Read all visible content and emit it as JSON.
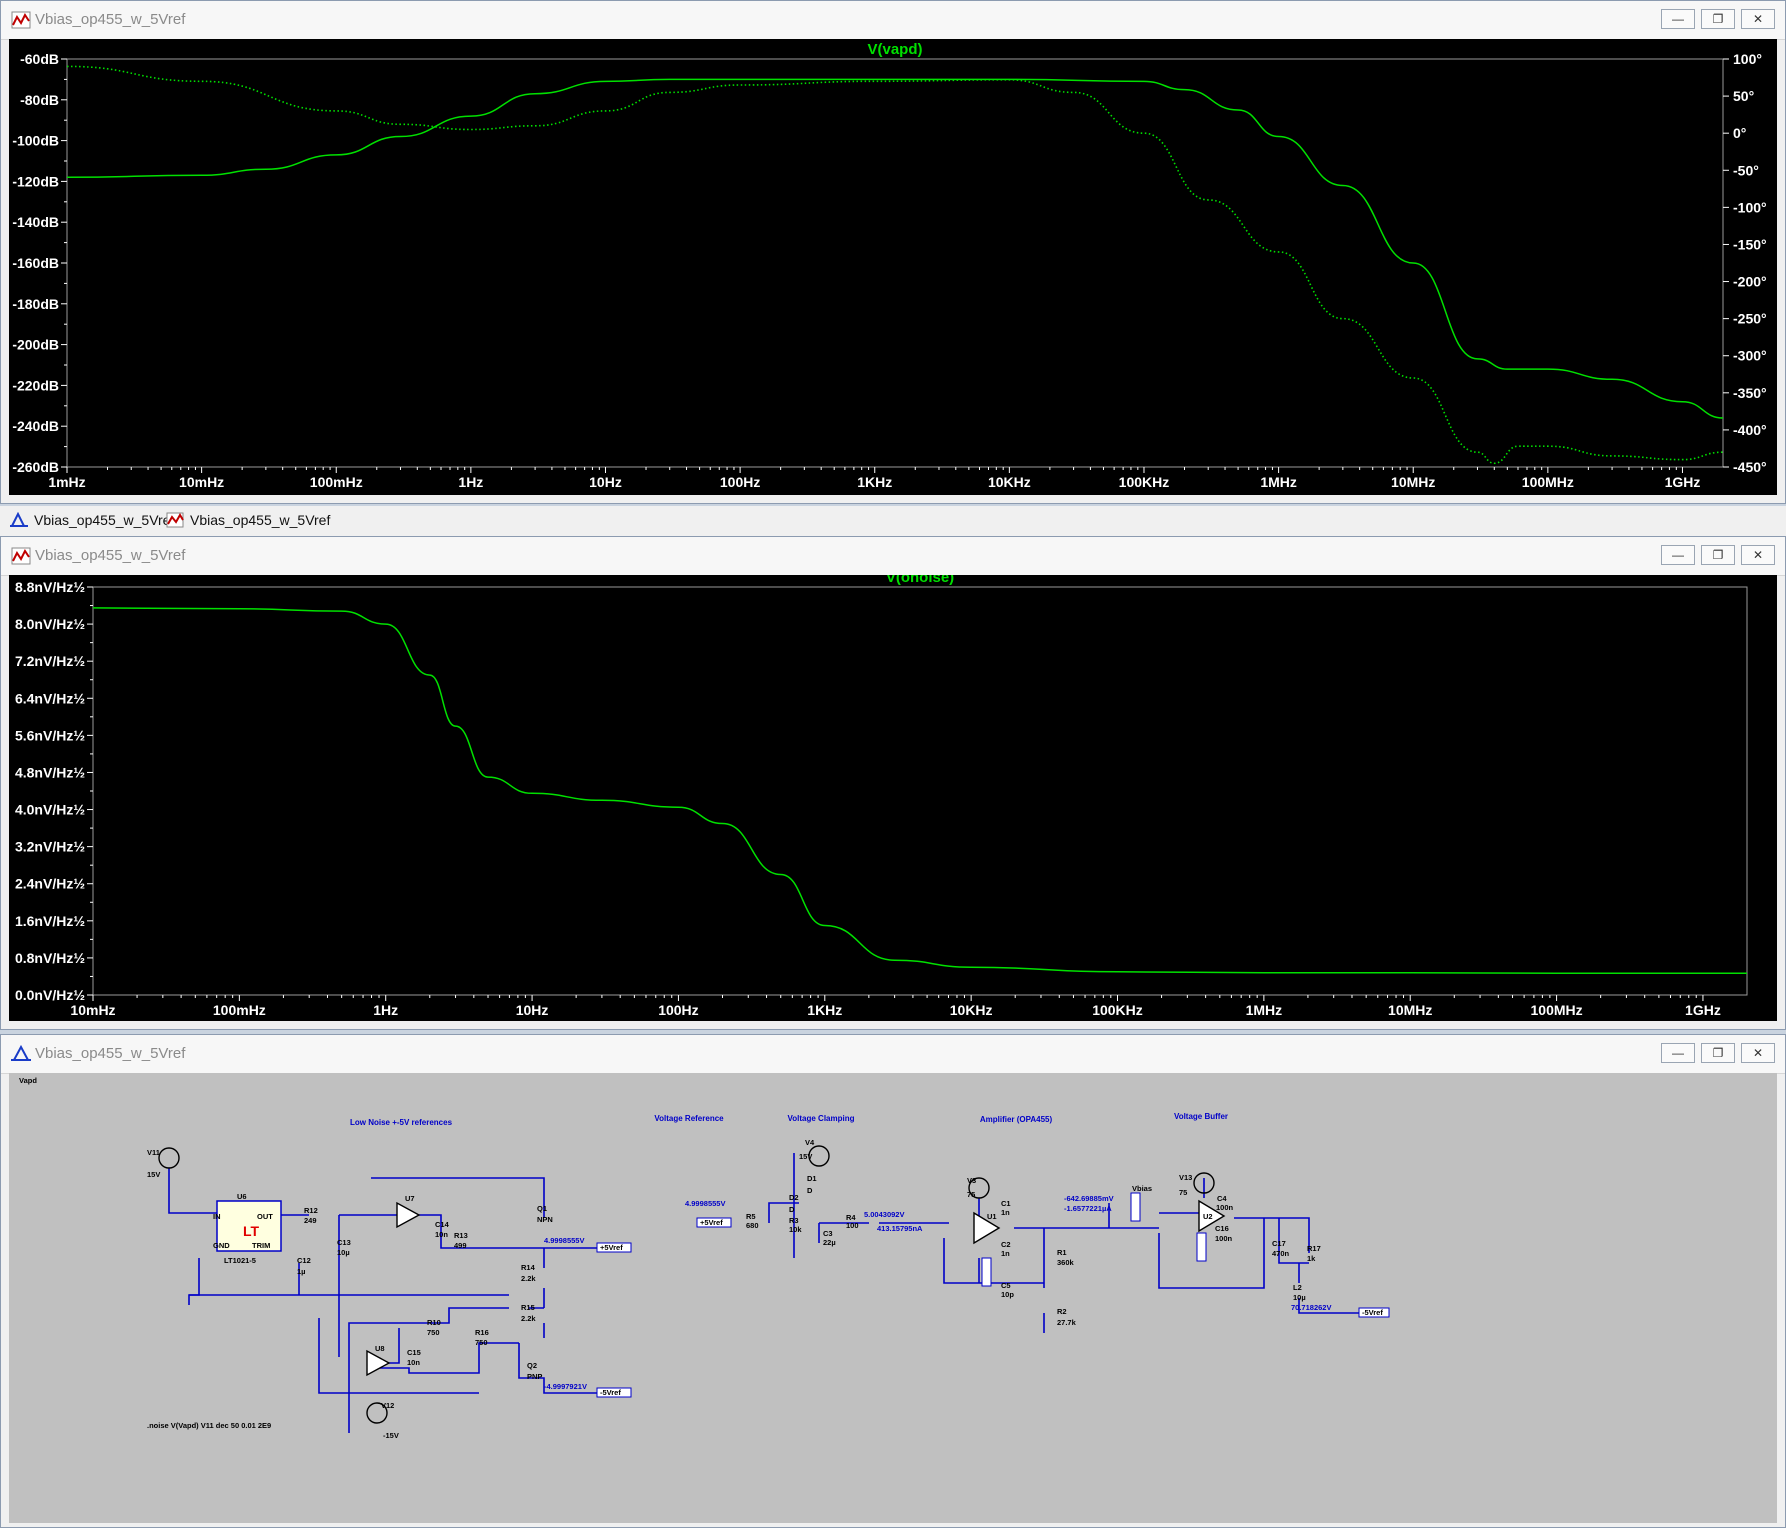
{
  "windows": {
    "bode": {
      "title": "Vbias_op455_w_5Vref",
      "trace": "V(vapd)"
    },
    "noise": {
      "title": "Vbias_op455_w_5Vref",
      "trace": "V(onoise)"
    },
    "schematic": {
      "title": "Vbias_op455_w_5Vref"
    }
  },
  "tabs": [
    {
      "label": "Vbias_op455_w_5Vref",
      "icon": "schematic-icon"
    },
    {
      "label": "Vbias_op455_w_5Vref",
      "icon": "waveform-icon"
    }
  ],
  "colors": {
    "trace": "#00e000",
    "plot_bg": "#000000",
    "axis_text": "#ffffff",
    "wire": "#0000c8",
    "schem_bg": "#c0c0c0"
  },
  "chart_data": [
    {
      "type": "line",
      "title": "V(vapd)",
      "x_scale": "log",
      "x_ticks": [
        "1mHz",
        "10mHz",
        "100mHz",
        "1Hz",
        "10Hz",
        "100Hz",
        "1KHz",
        "10KHz",
        "100KHz",
        "1MHz",
        "10MHz",
        "100MHz",
        "1GHz"
      ],
      "y_ticks": [
        "-60dB",
        "-80dB",
        "-100dB",
        "-120dB",
        "-140dB",
        "-160dB",
        "-180dB",
        "-200dB",
        "-220dB",
        "-240dB",
        "-260dB"
      ],
      "y2_ticks": [
        "100°",
        "50°",
        "0°",
        "-50°",
        "-100°",
        "-150°",
        "-200°",
        "-250°",
        "-300°",
        "-350°",
        "-400°",
        "-450°"
      ],
      "ylim": [
        -260,
        -60
      ],
      "y2lim": [
        -450,
        100
      ],
      "series": [
        {
          "style": "solid",
          "x": [
            0.001,
            0.01,
            0.03,
            0.1,
            0.3,
            1,
            3,
            10,
            30,
            100,
            1000,
            10000,
            100000,
            200000,
            500000,
            1000000,
            3000000,
            10000000,
            30000000,
            50000000,
            100000000,
            300000000,
            1000000000,
            2000000000
          ],
          "values": [
            -118,
            -117,
            -114,
            -107,
            -98,
            -88,
            -77,
            -71,
            -70,
            -70,
            -70,
            -70,
            -71,
            -75,
            -85,
            -98,
            -122,
            -160,
            -207,
            -212,
            -212,
            -217,
            -228,
            -236
          ]
        },
        {
          "style": "dotted",
          "x": [
            0.001,
            0.01,
            0.1,
            0.3,
            1,
            3,
            10,
            30,
            100,
            1000,
            10000,
            30000,
            100000,
            300000,
            1000000,
            3000000,
            10000000,
            30000000,
            40000000,
            60000000,
            100000000,
            300000000,
            1000000000,
            2000000000
          ],
          "values": [
            90,
            70,
            30,
            12,
            5,
            10,
            30,
            55,
            65,
            70,
            72,
            55,
            0,
            -90,
            -160,
            -250,
            -330,
            -430,
            -445,
            -422,
            -422,
            -435,
            -440,
            -430
          ]
        }
      ]
    },
    {
      "type": "line",
      "title": "V(onoise)",
      "x_scale": "log",
      "x_ticks": [
        "10mHz",
        "100mHz",
        "1Hz",
        "10Hz",
        "100Hz",
        "1KHz",
        "10KHz",
        "100KHz",
        "1MHz",
        "10MHz",
        "100MHz",
        "1GHz"
      ],
      "y_ticks": [
        "8.8nV/Hz½",
        "8.0nV/Hz½",
        "7.2nV/Hz½",
        "6.4nV/Hz½",
        "5.6nV/Hz½",
        "4.8nV/Hz½",
        "4.0nV/Hz½",
        "3.2nV/Hz½",
        "2.4nV/Hz½",
        "1.6nV/Hz½",
        "0.8nV/Hz½",
        "0.0nV/Hz½"
      ],
      "ylim": [
        0,
        8.8
      ],
      "series": [
        {
          "style": "solid",
          "x": [
            0.01,
            0.1,
            0.5,
            1,
            2,
            3,
            5,
            10,
            30,
            100,
            200,
            500,
            1000,
            3000,
            10000,
            100000,
            1000000,
            10000000,
            100000000,
            2000000000
          ],
          "values": [
            8.35,
            8.33,
            8.28,
            8.0,
            6.9,
            5.8,
            4.7,
            4.35,
            4.2,
            4.05,
            3.7,
            2.6,
            1.5,
            0.75,
            0.6,
            0.5,
            0.48,
            0.48,
            0.47,
            0.47
          ]
        }
      ]
    }
  ],
  "schematic": {
    "section_titles": [
      "Low Noise +-5V references",
      "Voltage Reference",
      "Voltage Clamping",
      "Amplifier (OPA455)",
      "Voltage Buffer"
    ],
    "labels": [
      "V11",
      "15V",
      "U6",
      "IN",
      "OUT",
      "GND",
      "TRIM",
      "LT1021-5",
      "C12",
      "1µ",
      "R12",
      "249",
      "C13",
      "10µ",
      "U7",
      "C14",
      "10n",
      "R13",
      "499",
      "Q1",
      "NPN",
      "R14",
      "2.2k",
      "R15",
      "2.2k",
      "R10",
      "750",
      "R16",
      "750",
      "U8",
      "C15",
      "10n",
      "Q2",
      "PNP",
      "V12",
      "-15V",
      "V4",
      "15V",
      "D1",
      "D",
      "D2",
      "D",
      "R5",
      "680",
      "R3",
      "10k",
      "C3",
      "22µ",
      "R4",
      "100",
      "V3",
      "75",
      "C1",
      "1n",
      "U1",
      "C2",
      "1n",
      "C5",
      "10p",
      "R1",
      "360k",
      "R2",
      "27.7k",
      "Vbias",
      "V13",
      "75",
      "C4",
      "100n",
      "U2",
      "C16",
      "100n",
      "C17",
      "470n",
      "R17",
      "1k",
      "L2",
      "10µ",
      "+5Vref",
      "-5Vref",
      "+5Vref",
      "-5Vref",
      "Vapd"
    ],
    "node_values": [
      "4.9998555V",
      "-4.9997921V",
      "4.9998555V",
      "5.0043092V",
      "413.15795nA",
      "-642.69885mV",
      "-1.6577221µA",
      "70.718262V"
    ],
    "directive": ".noise V(Vapd) V11 dec 50 0.01 2E9"
  }
}
